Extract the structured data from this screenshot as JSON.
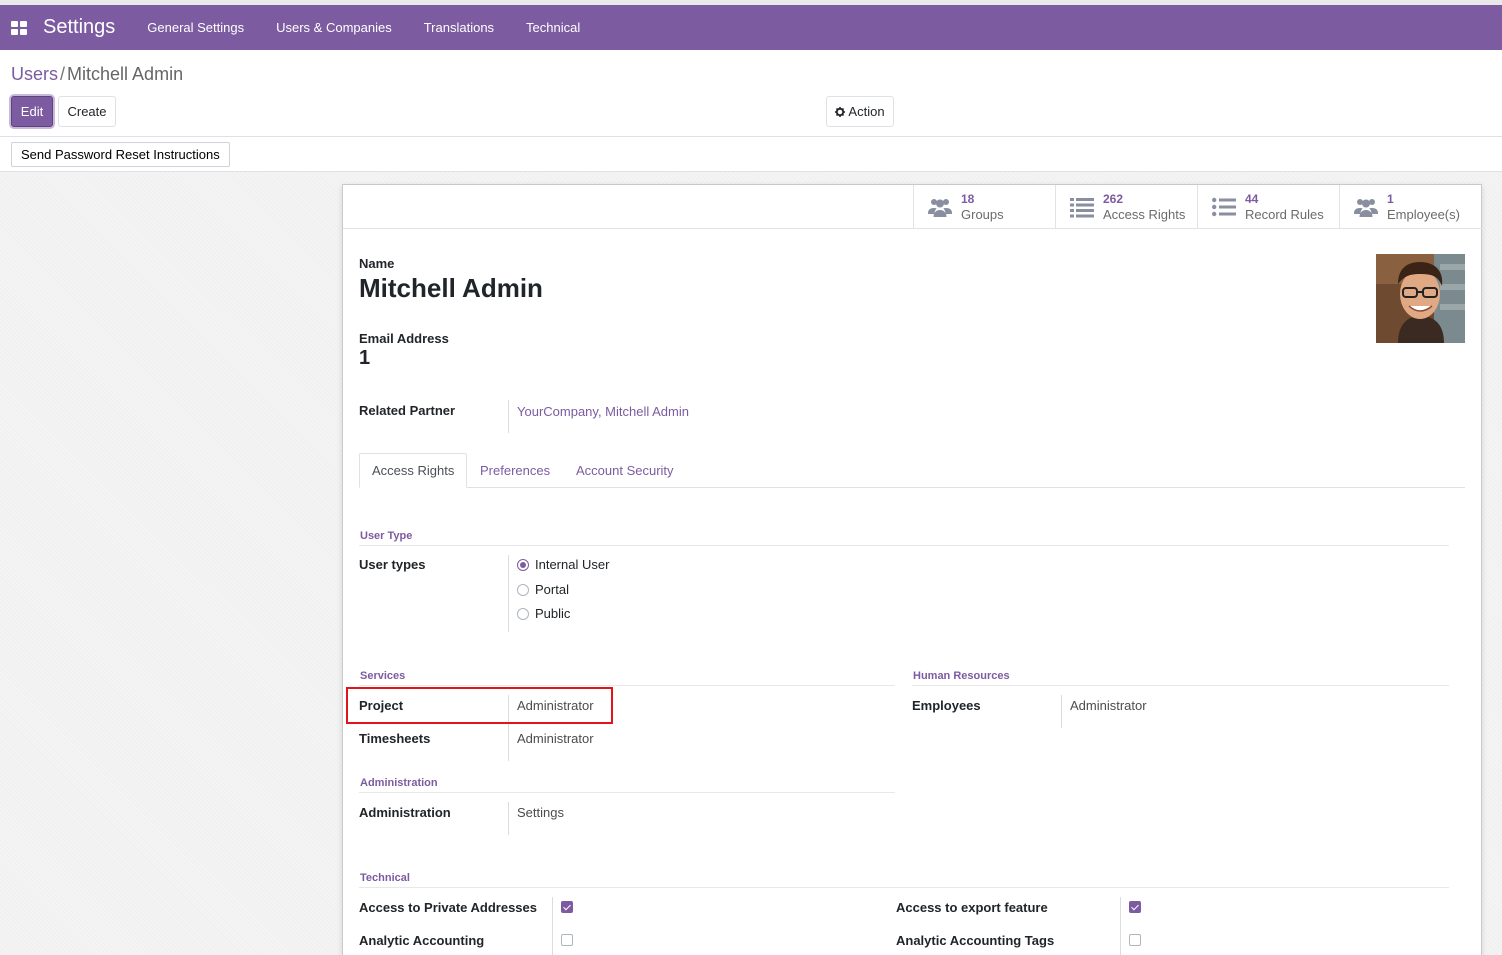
{
  "navbar": {
    "brand": "Settings",
    "menu": [
      "General Settings",
      "Users & Companies",
      "Translations",
      "Technical"
    ]
  },
  "breadcrumb": {
    "parent": "Users",
    "separator": "/",
    "current": "Mitchell Admin"
  },
  "buttons": {
    "edit": "Edit",
    "create": "Create",
    "action": "Action",
    "reset_password": "Send Password Reset Instructions"
  },
  "stats": [
    {
      "value": "18",
      "label": "Groups",
      "icon": "users-icon"
    },
    {
      "value": "262",
      "label": "Access Rights",
      "icon": "list-icon"
    },
    {
      "value": "44",
      "label": "Record Rules",
      "icon": "list-ul-icon"
    },
    {
      "value": "1",
      "label": "Employee(s)",
      "icon": "users-icon"
    }
  ],
  "form": {
    "name_label": "Name",
    "name": "Mitchell Admin",
    "email_label": "Email Address",
    "email": "1",
    "partner_label": "Related Partner",
    "partner": "YourCompany, Mitchell Admin"
  },
  "tabs": [
    "Access Rights",
    "Preferences",
    "Account Security"
  ],
  "user_type": {
    "section": "User Type",
    "label": "User types",
    "options": [
      "Internal User",
      "Portal",
      "Public"
    ],
    "selected": "Internal User"
  },
  "services": {
    "section": "Services",
    "project_label": "Project",
    "project_value": "Administrator",
    "timesheets_label": "Timesheets",
    "timesheets_value": "Administrator"
  },
  "human_resources": {
    "section": "Human Resources",
    "employees_label": "Employees",
    "employees_value": "Administrator"
  },
  "administration": {
    "section": "Administration",
    "label": "Administration",
    "value": "Settings"
  },
  "technical": {
    "section": "Technical",
    "private_addresses_label": "Access to Private Addresses",
    "private_addresses_checked": true,
    "export_label": "Access to export feature",
    "export_checked": true,
    "analytic_label": "Analytic Accounting",
    "analytic_checked": false,
    "analytic_tags_label": "Analytic Accounting Tags",
    "analytic_tags_checked": false
  },
  "colors": {
    "brand": "#7c5ba1",
    "highlight": "#e0141b"
  }
}
